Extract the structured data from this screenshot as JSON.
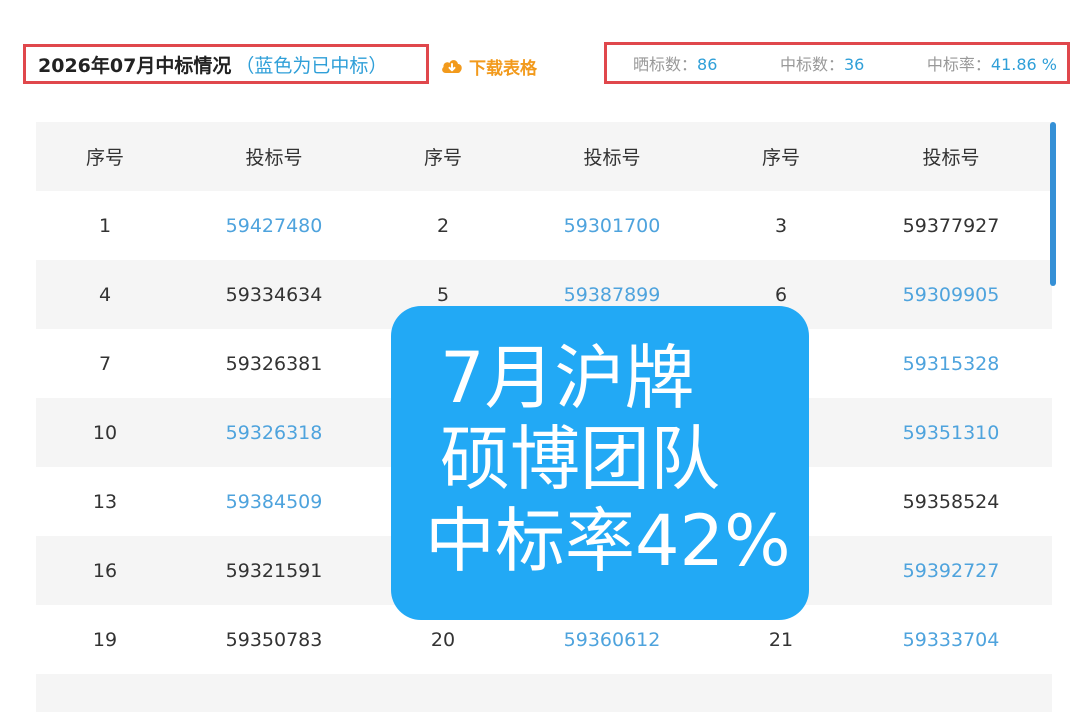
{
  "header": {
    "title": "2026年07月中标情况",
    "title_note": "（蓝色为已中标）",
    "download_label": "下载表格",
    "download_icon": "cloud-download-icon"
  },
  "stats": {
    "shown_label": "晒标数：",
    "shown_value": "86",
    "won_label": "中标数：",
    "won_value": "36",
    "rate_label": "中标率：",
    "rate_value": "41.86 %"
  },
  "table": {
    "headers": [
      "序号",
      "投标号",
      "序号",
      "投标号",
      "序号",
      "投标号"
    ],
    "rows": [
      [
        {
          "i": "1",
          "b": "59427480",
          "won": true
        },
        {
          "i": "2",
          "b": "59301700",
          "won": true
        },
        {
          "i": "3",
          "b": "59377927",
          "won": false
        }
      ],
      [
        {
          "i": "4",
          "b": "59334634",
          "won": false
        },
        {
          "i": "5",
          "b": "59387899",
          "won": true
        },
        {
          "i": "6",
          "b": "59309905",
          "won": true
        }
      ],
      [
        {
          "i": "7",
          "b": "59326381",
          "won": false
        },
        {
          "i": "",
          "b": "",
          "won": false
        },
        {
          "i": "",
          "b": "59315328",
          "won": true
        }
      ],
      [
        {
          "i": "10",
          "b": "59326318",
          "won": true
        },
        {
          "i": "",
          "b": "",
          "won": false
        },
        {
          "i": "",
          "b": "59351310",
          "won": true
        }
      ],
      [
        {
          "i": "13",
          "b": "59384509",
          "won": true
        },
        {
          "i": "",
          "b": "",
          "won": false
        },
        {
          "i": "",
          "b": "59358524",
          "won": false
        }
      ],
      [
        {
          "i": "16",
          "b": "59321591",
          "won": false
        },
        {
          "i": "",
          "b": "",
          "won": false
        },
        {
          "i": "",
          "b": "59392727",
          "won": true
        }
      ],
      [
        {
          "i": "19",
          "b": "59350783",
          "won": false
        },
        {
          "i": "20",
          "b": "59360612",
          "won": true
        },
        {
          "i": "21",
          "b": "59333704",
          "won": true
        }
      ],
      [
        {
          "i": "",
          "b": "",
          "won": false
        },
        {
          "i": "",
          "b": "",
          "won": false
        },
        {
          "i": "",
          "b": "",
          "won": false
        }
      ]
    ]
  },
  "overlay": {
    "line1": "7月沪牌",
    "line2": "硕博团队",
    "line3": "中标率42%"
  },
  "colors": {
    "won": "#4ea3dd",
    "accent_red": "#e0474c",
    "download_orange": "#f29a1c",
    "overlay_blue": "#22a9f5"
  }
}
